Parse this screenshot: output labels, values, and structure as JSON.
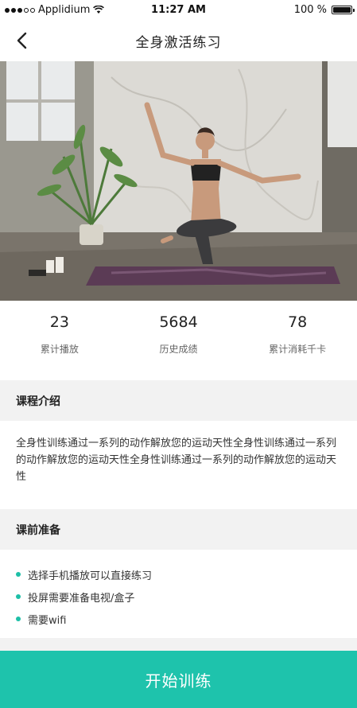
{
  "status_bar": {
    "carrier": "Applidium",
    "time": "11:27 AM",
    "battery_percent": "100 %",
    "battery_level": 1.0
  },
  "nav": {
    "title": "全身激活练习",
    "back_icon": "chevron-left-icon"
  },
  "hero": {
    "description_icon": "yoga-photo"
  },
  "stats": [
    {
      "value": "23",
      "label": "累计播放"
    },
    {
      "value": "5684",
      "label": "历史成绩"
    },
    {
      "value": "78",
      "label": "累计消耗千卡"
    }
  ],
  "intro": {
    "heading": "课程介绍",
    "body": "全身性训练通过一系列的动作解放您的运动天性全身性训练通过一系列的动作解放您的运动天性全身性训练通过一系列的动作解放您的运动天性"
  },
  "prep": {
    "heading": "课前准备",
    "items": [
      "选择手机播放可以直接练习",
      "投屏需要准备电视/盒子",
      "需要wifi"
    ]
  },
  "start_button": {
    "label": "开始训练"
  },
  "colors": {
    "accent": "#1ec3ac",
    "section_bg": "#f2f2f2"
  }
}
